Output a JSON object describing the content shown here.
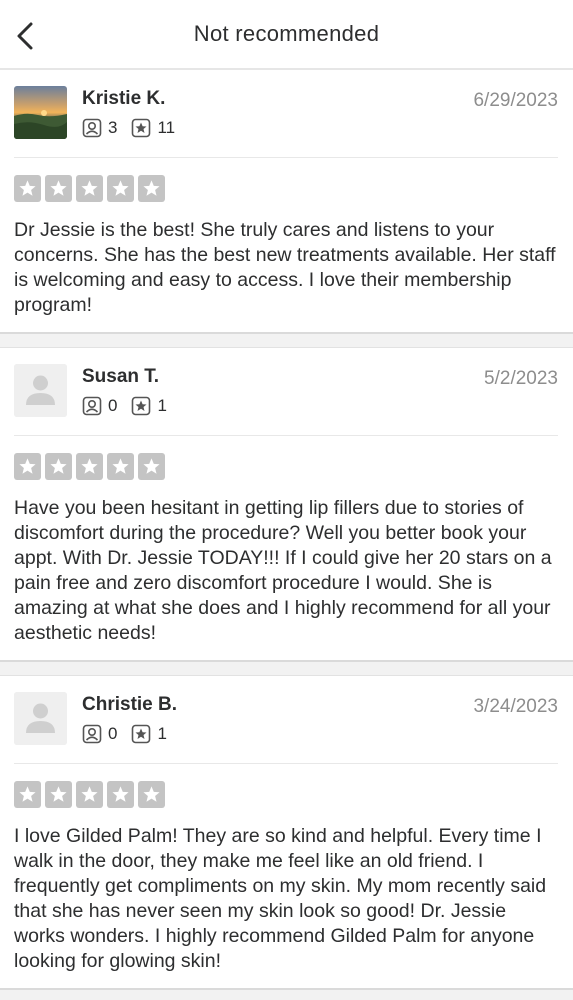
{
  "header": {
    "title": "Not recommended",
    "back_icon": "chevron-left-icon"
  },
  "colors": {
    "star_empty": "#c4c4c4",
    "date": "#8d8d8d",
    "text": "#2d2e2f"
  },
  "reviews": [
    {
      "name": "Kristie K.",
      "date": "6/29/2023",
      "friends": "3",
      "reviews_count": "11",
      "rating": 0,
      "text": "Dr Jessie is the best! She truly cares and listens to your concerns. She has the best new treatments available. Her staff is welcoming and easy to access. I love their membership program!"
    },
    {
      "name": "Susan T.",
      "date": "5/2/2023",
      "friends": "0",
      "reviews_count": "1",
      "rating": 0,
      "text": "Have you been hesitant in getting lip fillers due to stories of discomfort during the procedure?  Well you better book your appt. With Dr. Jessie TODAY!!!  If I could give her 20 stars on a pain free and zero discomfort procedure I would.  She is amazing at what she does and I highly recommend for all your aesthetic needs!"
    },
    {
      "name": "Christie B.",
      "date": "3/24/2023",
      "friends": "0",
      "reviews_count": "1",
      "rating": 0,
      "text": "I love Gilded Palm!  They are so kind and helpful. Every time I walk in the door, they make me feel like an old friend.  I frequently get compliments on my skin. My mom recently said that she has never seen my skin look so good! Dr. Jessie works wonders.  I highly recommend Gilded Palm for anyone looking for glowing skin!"
    }
  ]
}
